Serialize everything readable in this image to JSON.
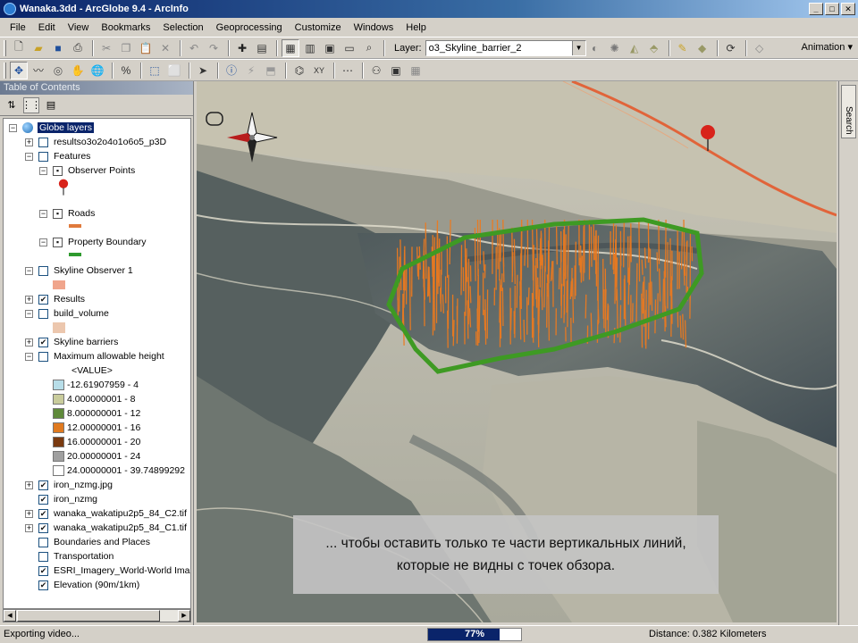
{
  "window": {
    "title": "Wanaka.3dd - ArcGlobe 9.4 - ArcInfo"
  },
  "menu": [
    "File",
    "Edit",
    "View",
    "Bookmarks",
    "Selection",
    "Geoprocessing",
    "Customize",
    "Windows",
    "Help"
  ],
  "toolbar": {
    "layer_label": "Layer:",
    "layer_value": "o3_Skyline_barrier_2",
    "animation_label": "Animation ▾"
  },
  "toc": {
    "header": "Table of Contents",
    "root": "Globe layers",
    "layers": {
      "results_3d": "resultso3o2o4o1o6o5_p3D",
      "features": "Features",
      "observer_points": "Observer Points",
      "roads": "Roads",
      "property_boundary": "Property Boundary",
      "skyline_observer": "Skyline Observer 1",
      "results": "Results",
      "build_volume": "build_volume",
      "skyline_barriers": "Skyline barriers",
      "max_height": "Maximum allowable height",
      "value_header": "<VALUE>",
      "iron_jpg": "iron_nzmg.jpg",
      "iron": "iron_nzmg",
      "c2": "wanaka_wakatipu2p5_84_C2.tif",
      "c1": "wanaka_wakatipu2p5_84_C1.tif",
      "boundaries": "Boundaries and Places",
      "transportation": "Transportation",
      "esri": "ESRI_Imagery_World-World Imag",
      "elevation": "Elevation (90m/1km)"
    },
    "legend": [
      {
        "label": "-12.61907959 - 4",
        "color": "#b7dde8"
      },
      {
        "label": "4.000000001 - 8",
        "color": "#c9cc9c"
      },
      {
        "label": "8.000000001 - 12",
        "color": "#5f8a3a"
      },
      {
        "label": "12.00000001 - 16",
        "color": "#e07a1f"
      },
      {
        "label": "16.00000001 - 20",
        "color": "#7a3a10"
      },
      {
        "label": "20.00000001 - 24",
        "color": "#a0a0a0"
      },
      {
        "label": "24.00000001 - 39.74899292",
        "color": "#ffffff"
      }
    ]
  },
  "map": {
    "subtitle": "... чтобы оставить только те части вертикальных линий, которые не видны с точек обзора."
  },
  "right_dock": {
    "search": "Search"
  },
  "status": {
    "left": "Exporting video...",
    "progress_percent": 77,
    "progress_label": "77%",
    "distance": "Distance:  0.382 Kilometers"
  }
}
